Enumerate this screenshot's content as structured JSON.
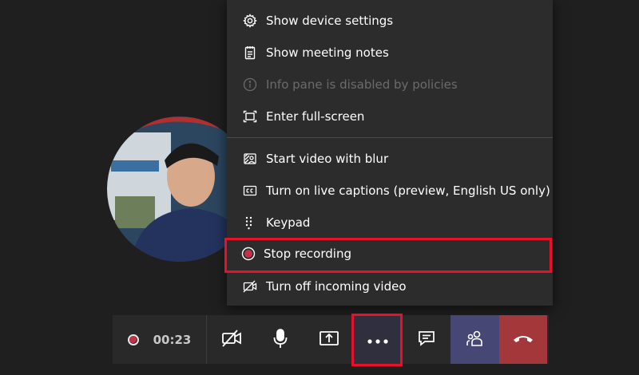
{
  "menu": {
    "items": [
      {
        "label": "Show device settings",
        "icon": "gear-icon",
        "disabled": false
      },
      {
        "label": "Show meeting notes",
        "icon": "notes-icon",
        "disabled": false
      },
      {
        "label": "Info pane is disabled by policies",
        "icon": "info-icon",
        "disabled": true
      },
      {
        "label": "Enter full-screen",
        "icon": "fullscreen-icon",
        "disabled": false
      },
      {
        "label": "Start video with blur",
        "icon": "blur-icon",
        "disabled": false
      },
      {
        "label": "Turn on live captions (preview, English US only)",
        "icon": "captions-icon",
        "disabled": false
      },
      {
        "label": "Keypad",
        "icon": "keypad-icon",
        "disabled": false
      },
      {
        "label": "Stop recording",
        "icon": "record-stop-icon",
        "disabled": false
      },
      {
        "label": "Turn off incoming video",
        "icon": "video-off-icon",
        "disabled": false
      }
    ]
  },
  "controls": {
    "timer": "00:23",
    "buttons": [
      "camera-off-icon",
      "microphone-icon",
      "share-screen-icon",
      "more-options-icon",
      "chat-icon",
      "participants-icon",
      "hang-up-icon"
    ]
  },
  "colors": {
    "highlight": "#e8102a",
    "record": "#c4314b",
    "hangup": "#a4373a",
    "participants_active": "#464775"
  }
}
